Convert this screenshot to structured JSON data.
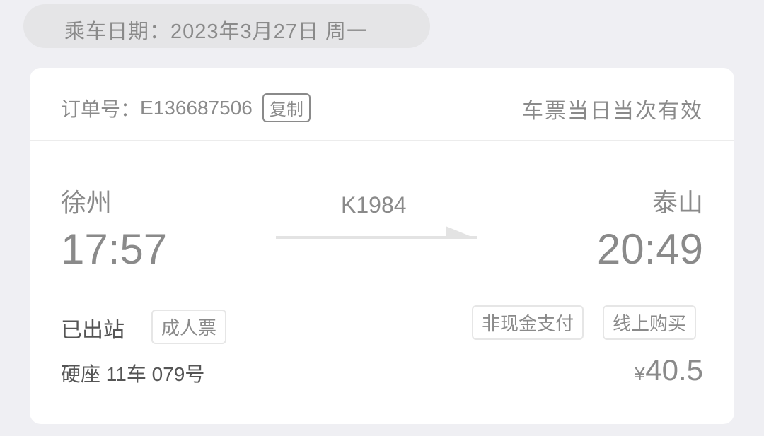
{
  "travel_date": "乘车日期：2023年3月27日 周一",
  "order": {
    "label": "订单号：",
    "number": "E136687506",
    "copy_label": "复制",
    "validity": "车票当日当次有效"
  },
  "trip": {
    "from_station": "徐州",
    "depart_time": "17:57",
    "train_number": "K1984",
    "to_station": "泰山",
    "arrive_time": "20:49"
  },
  "status": "已出站",
  "ticket_type": "成人票",
  "payment_tag": "非现金支付",
  "purchase_tag": "线上购买",
  "seat": "硬座 11车 079号",
  "price": {
    "currency": "¥",
    "amount": "40.5"
  },
  "icons": {
    "arrow": "right-arrow-icon"
  }
}
